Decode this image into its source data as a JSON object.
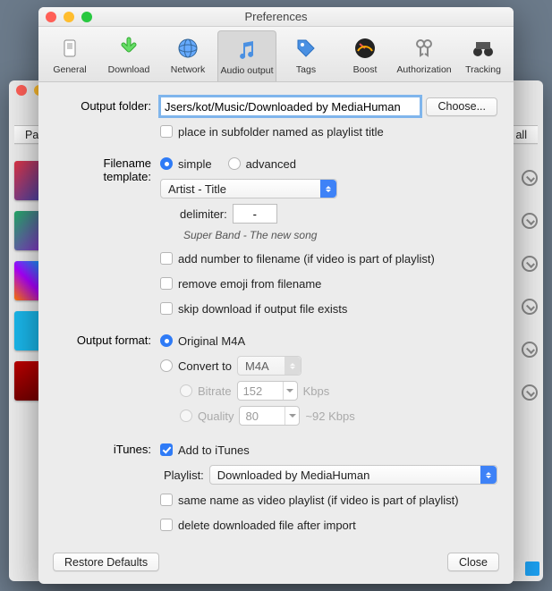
{
  "window": {
    "title": "Preferences"
  },
  "toolbar": {
    "items": [
      {
        "label": "General"
      },
      {
        "label": "Download"
      },
      {
        "label": "Network"
      },
      {
        "label": "Audio output"
      },
      {
        "label": "Tags"
      },
      {
        "label": "Boost"
      },
      {
        "label": "Authorization"
      },
      {
        "label": "Tracking"
      }
    ],
    "selected_index": 3
  },
  "bgapp": {
    "button_left": "Past",
    "button_right": "rt all"
  },
  "labels": {
    "output_folder": "Output folder:",
    "filename_template": "Filename template:",
    "output_format": "Output format:",
    "itunes": "iTunes:",
    "delimiter": "delimiter:",
    "bitrate": "Bitrate",
    "quality": "Quality",
    "playlist": "Playlist:",
    "kbps": "Kbps",
    "approx_kbps": "~92 Kbps"
  },
  "output_folder": {
    "path": "Jsers/kot/Music/Downloaded by MediaHuman",
    "choose": "Choose...",
    "subfolder_cb": "place in subfolder named as playlist title"
  },
  "template": {
    "simple": "simple",
    "advanced": "advanced",
    "pattern": "Artist - Title",
    "delimiter": "-",
    "example": "Super Band - The new song",
    "add_number": "add number to filename (if video is part of playlist)",
    "remove_emoji": "remove emoji from filename",
    "skip": "skip download if output file exists"
  },
  "format": {
    "original": "Original M4A",
    "convert_to": "Convert to",
    "convert_value": "M4A",
    "bitrate_value": "152",
    "quality_value": "80"
  },
  "itunes": {
    "add": "Add to iTunes",
    "playlist_value": "Downloaded by MediaHuman",
    "same_name": "same name as video playlist (if video is part of playlist)",
    "delete_after": "delete downloaded file after import"
  },
  "buttons": {
    "restore": "Restore Defaults",
    "close": "Close"
  }
}
